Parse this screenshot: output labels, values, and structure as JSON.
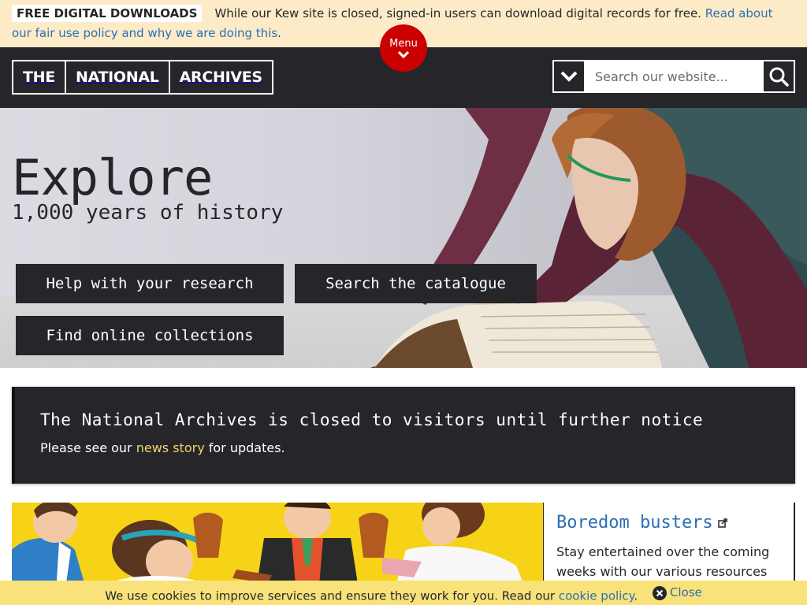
{
  "notice": {
    "tag": "FREE DIGITAL DOWNLOADS",
    "text": "While our Kew site is closed, signed-in users can download digital records for free.",
    "link": "Read about our fair use policy and why we are doing this",
    "end": "."
  },
  "header": {
    "logo": [
      "THE",
      "NATIONAL",
      "ARCHIVES"
    ],
    "menu_label": "Menu",
    "search_placeholder": "Search our website..."
  },
  "hero": {
    "title": "Explore",
    "subtitle": "1,000 years of history",
    "buttons": [
      "Help with your research",
      "Search the catalogue",
      "Find online collections"
    ]
  },
  "closure": {
    "title": "The National Archives is closed to visitors until further notice",
    "text_before": "Please see our",
    "link": "news story",
    "text_after": "for updates."
  },
  "feature": {
    "title": "Boredom busters",
    "description": "Stay entertained over the coming weeks with our various resources and"
  },
  "cookie": {
    "text": "We use cookies to improve services and ensure they work for you. Read our",
    "link": "cookie policy",
    "end": ".",
    "close_label": "Close"
  },
  "colors": {
    "brand_dark": "#26262a",
    "menu_red": "#cc0000",
    "link_blue": "#2b6fb4",
    "notice_bg": "#fdebc8",
    "cookie_bg": "#f9e27a",
    "link_yellow": "#f0d76a"
  },
  "icons": [
    "chevron-down-icon",
    "search-icon",
    "external-link-icon",
    "close-icon"
  ]
}
